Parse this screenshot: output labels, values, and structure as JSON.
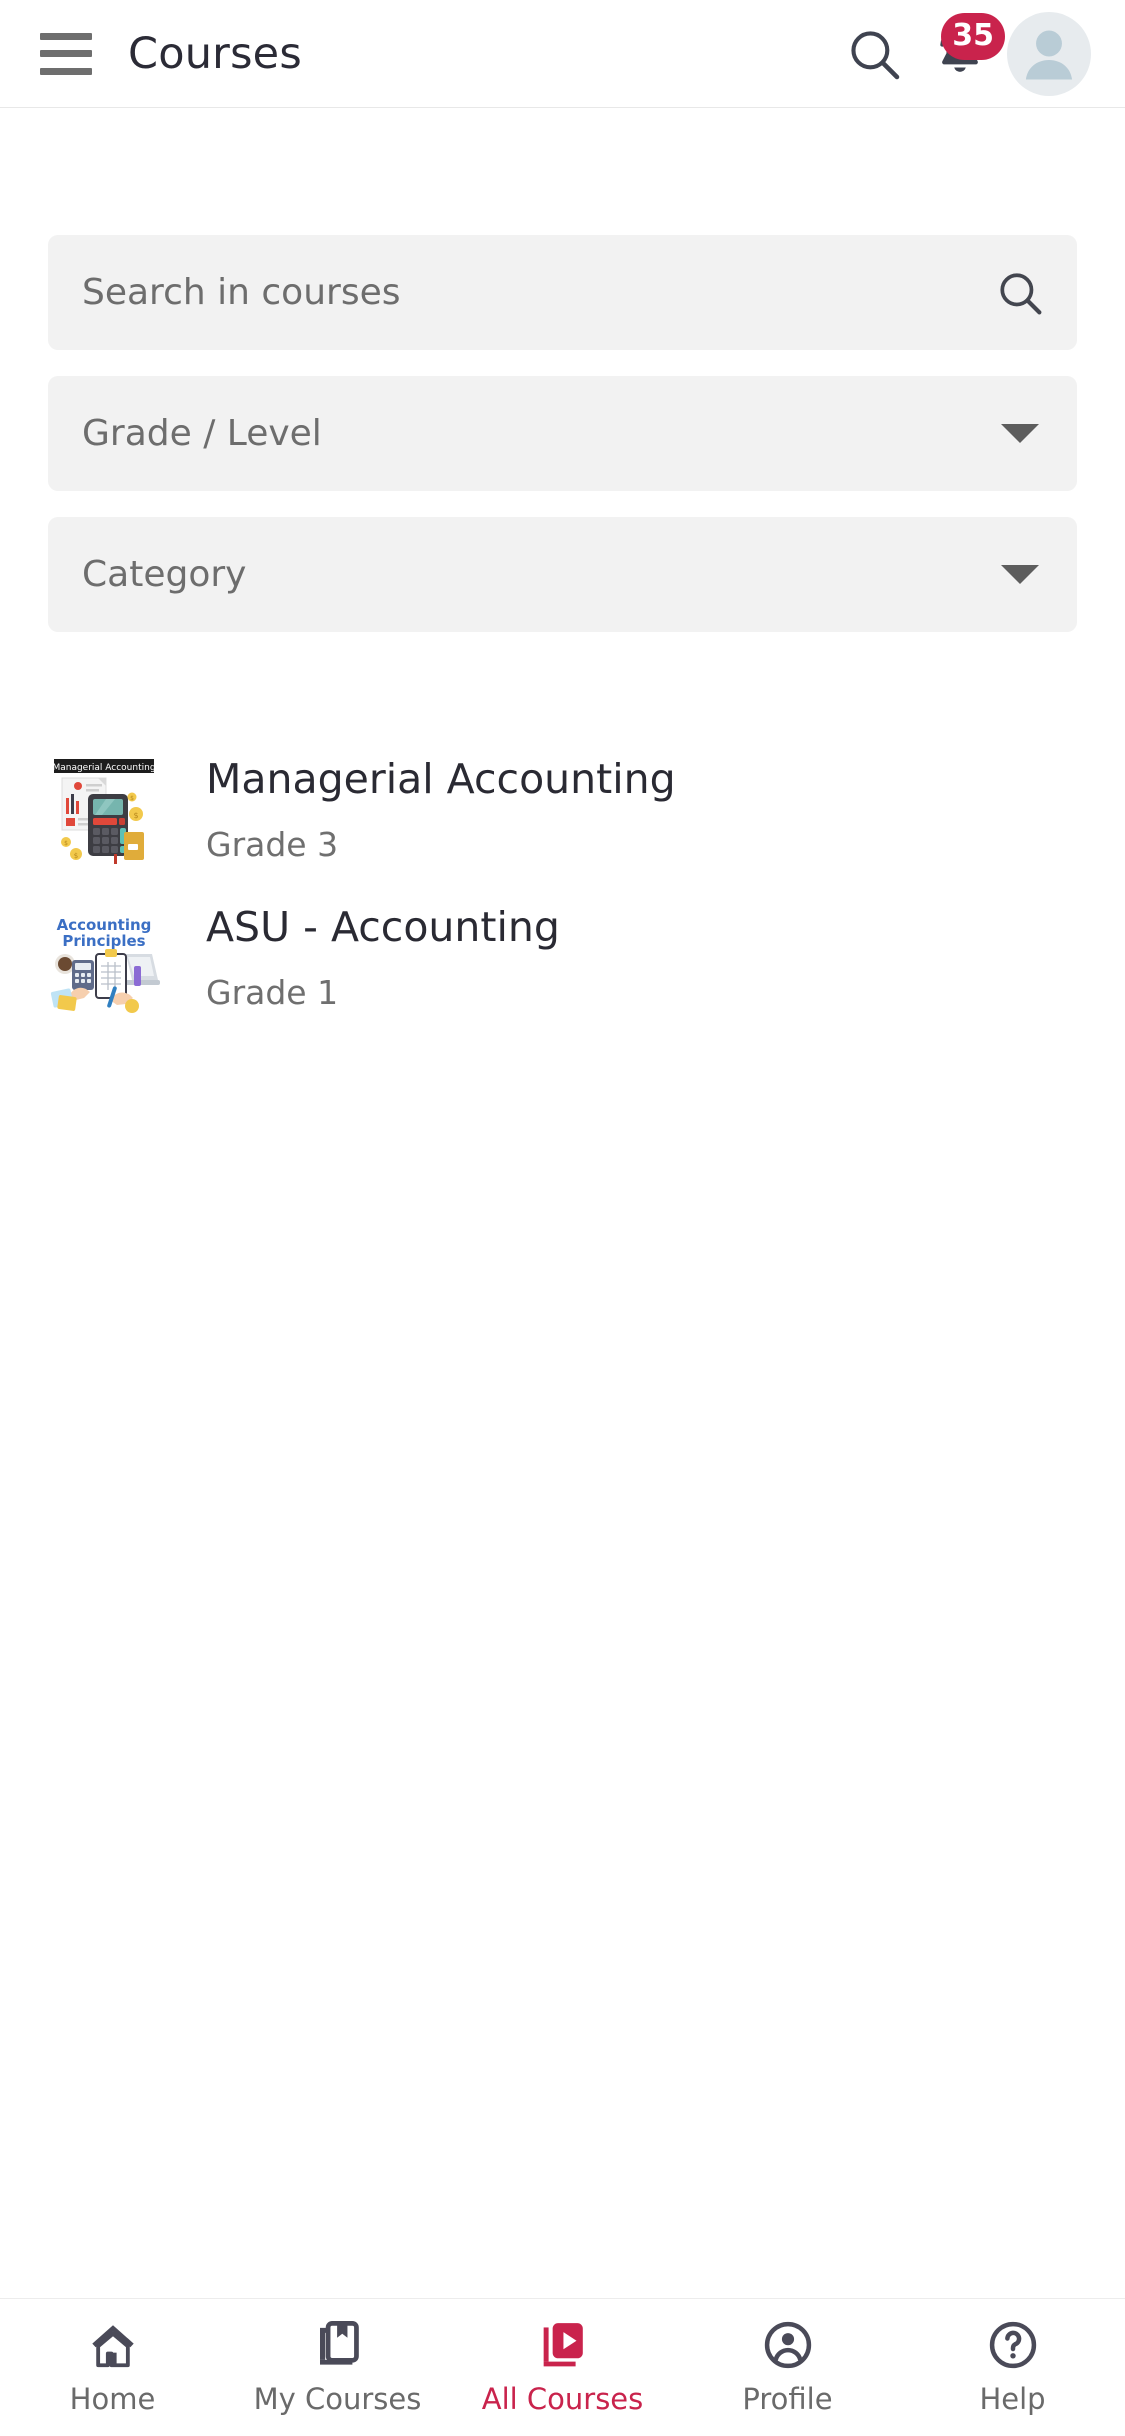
{
  "header": {
    "menu_icon": "hamburger-menu-icon",
    "title": "Courses",
    "search_icon": "search-icon",
    "notifications_icon": "bell-icon",
    "notifications_count": "35",
    "avatar_icon": "user-avatar-icon",
    "badge_color": "#C9234C"
  },
  "filters": {
    "search": {
      "placeholder": "Search in courses",
      "value": "",
      "icon": "search-icon"
    },
    "grade_level": {
      "label": "Grade / Level",
      "value": "",
      "icon": "chevron-down-icon"
    },
    "category": {
      "label": "Category",
      "value": "",
      "icon": "chevron-down-icon"
    }
  },
  "courses": [
    {
      "title": "Managerial Accounting",
      "grade": "Grade 3",
      "thumbnail_name": "managerial-accounting-thumbnail",
      "thumbnail_caption": "Managerial Accounting"
    },
    {
      "title": "ASU - Accounting",
      "grade": "Grade 1",
      "thumbnail_name": "accounting-principles-thumbnail",
      "thumbnail_caption": "Accounting Principles"
    }
  ],
  "bottom_nav": {
    "active_color": "#C9234C",
    "inactive_color": "#4a4a58",
    "items": [
      {
        "label": "Home",
        "icon": "home-icon",
        "active": false
      },
      {
        "label": "My Courses",
        "icon": "book-bookmark-icon",
        "active": false
      },
      {
        "label": "All Courses",
        "icon": "book-play-icon",
        "active": true
      },
      {
        "label": "Profile",
        "icon": "person-circle-icon",
        "active": false
      },
      {
        "label": "Help",
        "icon": "question-circle-icon",
        "active": false
      }
    ]
  }
}
